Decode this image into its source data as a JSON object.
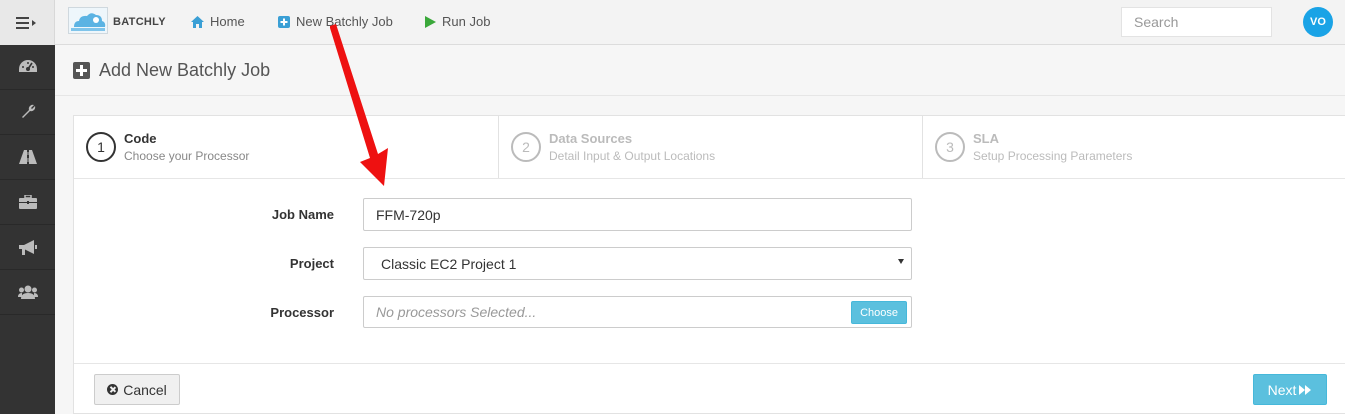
{
  "header": {
    "brand": "BATCHLY",
    "nav": [
      {
        "label": "Home",
        "icon": "home-icon"
      },
      {
        "label": "New Batchly Job",
        "icon": "plus-square-icon"
      },
      {
        "label": "Run Job",
        "icon": "play-icon"
      }
    ],
    "search_placeholder": "Search",
    "avatar_initials": "VO"
  },
  "sidebar": {
    "items": [
      {
        "icon": "dashboard-icon"
      },
      {
        "icon": "wrench-icon"
      },
      {
        "icon": "road-icon"
      },
      {
        "icon": "briefcase-icon"
      },
      {
        "icon": "bullhorn-icon"
      },
      {
        "icon": "users-icon"
      }
    ]
  },
  "page": {
    "title": "Add New Batchly Job"
  },
  "wizard": {
    "steps": [
      {
        "num": "1",
        "title": "Code",
        "subtitle": "Choose your Processor",
        "active": true
      },
      {
        "num": "2",
        "title": "Data Sources",
        "subtitle": "Detail Input & Output Locations",
        "active": false
      },
      {
        "num": "3",
        "title": "SLA",
        "subtitle": "Setup Processing Parameters",
        "active": false
      }
    ]
  },
  "form": {
    "job_name_label": "Job Name",
    "job_name_value": "FFM-720p",
    "project_label": "Project",
    "project_value": "Classic EC2 Project 1",
    "processor_label": "Processor",
    "processor_placeholder": "No processors Selected...",
    "choose_label": "Choose"
  },
  "footer": {
    "cancel_label": "Cancel",
    "next_label": "Next"
  },
  "colors": {
    "accent": "#5bc0de",
    "avatar": "#1aa3e6",
    "sidebar": "#333333",
    "annotation_arrow": "#ee1111"
  }
}
